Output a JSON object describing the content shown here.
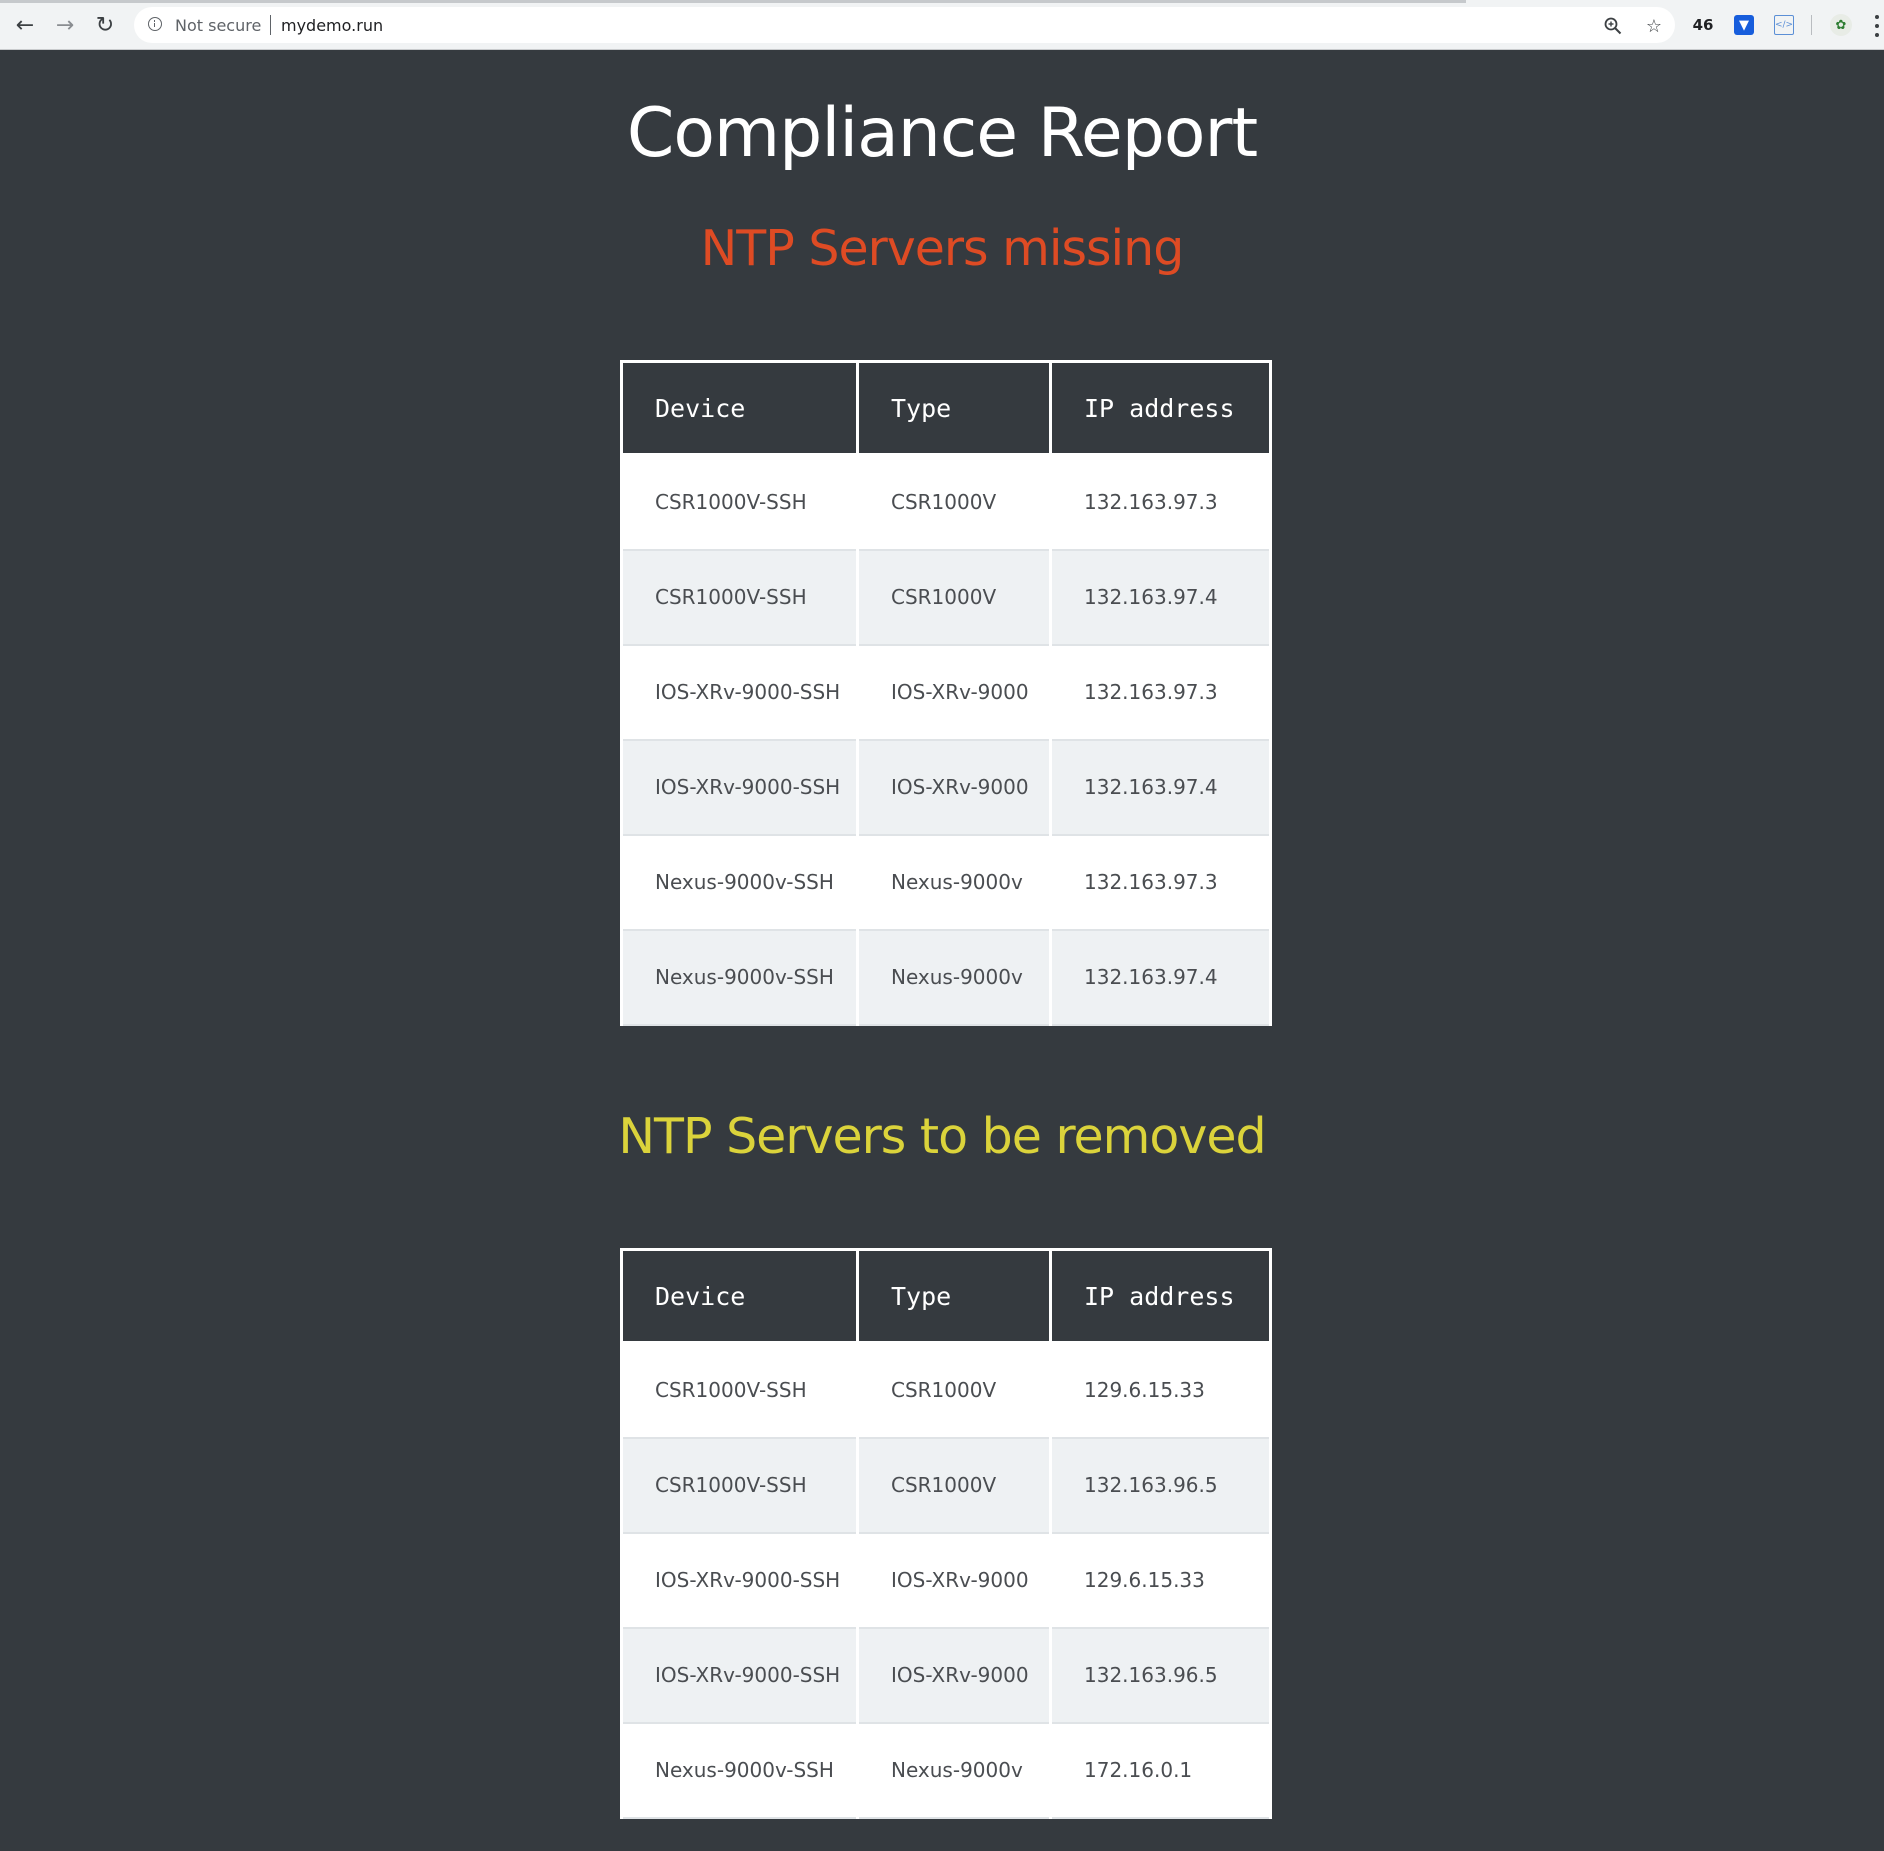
{
  "browser": {
    "security_label": "Not secure",
    "url": "mydemo.run",
    "extension_badge": "46"
  },
  "page": {
    "title": "Compliance Report"
  },
  "sections": [
    {
      "heading": "NTP Servers missing",
      "columns": [
        "Device",
        "Type",
        "IP address"
      ],
      "rows": [
        [
          "CSR1000V-SSH",
          "CSR1000V",
          "132.163.97.3"
        ],
        [
          "CSR1000V-SSH",
          "CSR1000V",
          "132.163.97.4"
        ],
        [
          "IOS-XRv-9000-SSH",
          "IOS-XRv-9000",
          "132.163.97.3"
        ],
        [
          "IOS-XRv-9000-SSH",
          "IOS-XRv-9000",
          "132.163.97.4"
        ],
        [
          "Nexus-9000v-SSH",
          "Nexus-9000v",
          "132.163.97.3"
        ],
        [
          "Nexus-9000v-SSH",
          "Nexus-9000v",
          "132.163.97.4"
        ]
      ]
    },
    {
      "heading": "NTP Servers to be removed",
      "columns": [
        "Device",
        "Type",
        "IP address"
      ],
      "rows": [
        [
          "CSR1000V-SSH",
          "CSR1000V",
          "129.6.15.33"
        ],
        [
          "CSR1000V-SSH",
          "CSR1000V",
          "132.163.96.5"
        ],
        [
          "IOS-XRv-9000-SSH",
          "IOS-XRv-9000",
          "129.6.15.33"
        ],
        [
          "IOS-XRv-9000-SSH",
          "IOS-XRv-9000",
          "132.163.96.5"
        ],
        [
          "Nexus-9000v-SSH",
          "Nexus-9000v",
          "172.16.0.1"
        ]
      ]
    }
  ],
  "colors": {
    "page_background": "#353a3f",
    "heading_missing": "#de4b24",
    "heading_removed": "#dbd33b",
    "table_header_background": "#353a3f",
    "row_stripe": "#eef1f3"
  },
  "icons": {
    "back": "back-arrow-icon",
    "forward": "forward-arrow-icon",
    "reload": "reload-icon",
    "info": "info-icon",
    "zoom": "zoom-icon",
    "bookmark": "star-icon",
    "bitwarden": "bitwarden-extension-icon",
    "code": "code-extension-icon",
    "profile": "profile-avatar-icon",
    "menu": "kebab-menu-icon"
  }
}
